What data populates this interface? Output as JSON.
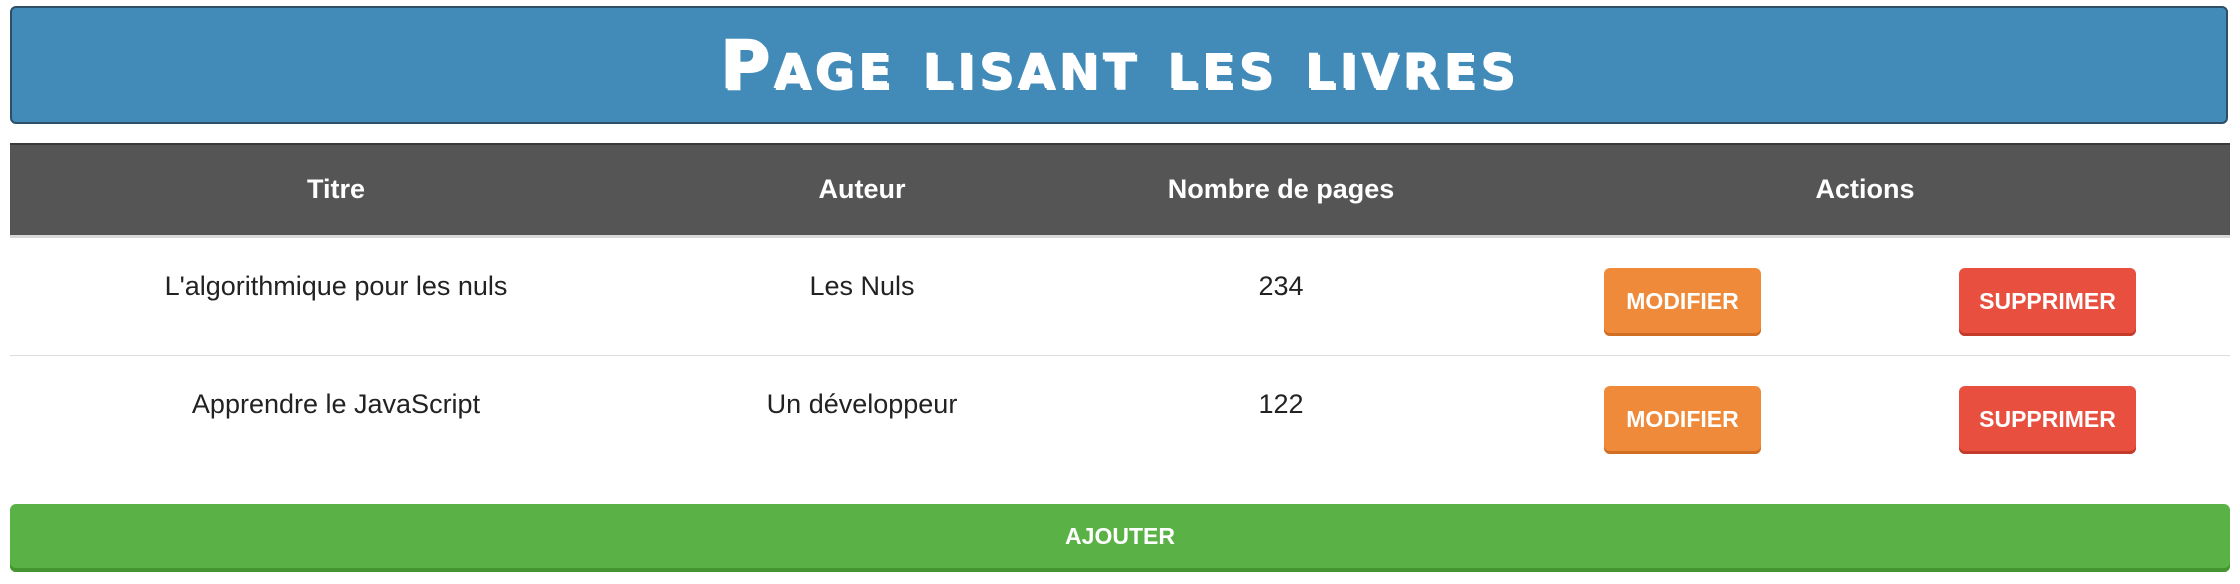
{
  "header": {
    "title": "Page lisant les livres"
  },
  "table": {
    "columns": {
      "title": "Titre",
      "author": "Auteur",
      "pages": "Nombre de pages",
      "actions": "Actions"
    },
    "rows": [
      {
        "title": "L'algorithmique pour les nuls",
        "author": "Les Nuls",
        "pages": "234",
        "edit_label": "Modifier",
        "delete_label": "Supprimer"
      },
      {
        "title": "Apprendre le JavaScript",
        "author": "Un développeur",
        "pages": "122",
        "edit_label": "Modifier",
        "delete_label": "Supprimer"
      }
    ]
  },
  "add_button": {
    "label": "Ajouter"
  },
  "colors": {
    "header_bg": "#428bb9",
    "table_header_bg": "#555555",
    "edit_button": "#ef8a3a",
    "delete_button": "#e84f3f",
    "add_button": "#5ab246"
  }
}
